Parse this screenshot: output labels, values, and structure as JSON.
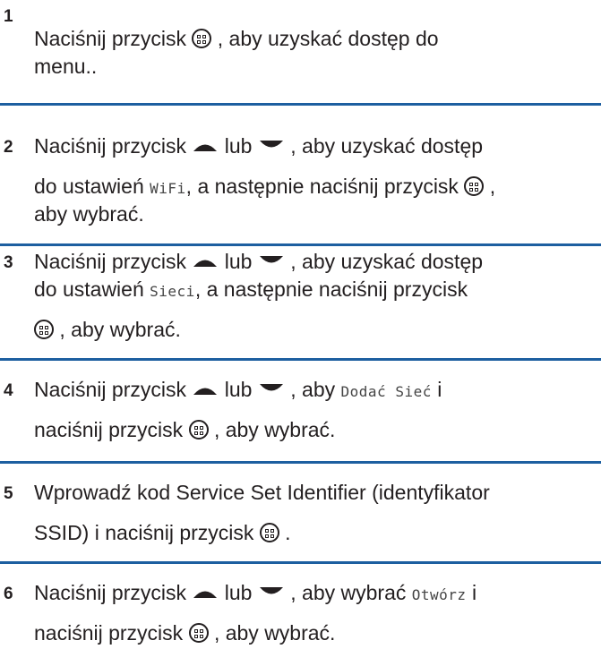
{
  "steps": [
    {
      "number": "1",
      "line1_pre": "Naciśnij przycisk",
      "line1_post": ", aby uzyskać dostęp do",
      "line2": "menu.."
    },
    {
      "number": "2",
      "line1_pre": "Naciśnij przycisk",
      "line1_or": "lub",
      "line1_post": ", aby uzyskać dostęp",
      "line2_pre": "do ustawień",
      "line2_mono": "WiFi",
      "line2_post": ", a następnie naciśnij przycisk",
      "line2_tail": ",",
      "line3": "aby wybrać."
    },
    {
      "number": "3",
      "line1_pre": "Naciśnij przycisk",
      "line1_or": "lub",
      "line1_post": ", aby uzyskać dostęp",
      "line2_pre": "do ustawień",
      "line2_mono": "Sieci",
      "line2_post": ", a następnie naciśnij przycisk",
      "line3_post": ", aby wybrać."
    },
    {
      "number": "4",
      "line1_pre": "Naciśnij przycisk",
      "line1_or": "lub",
      "line1_post": ", aby",
      "line1_mono": "Dodać Sieć",
      "line1_tail": "i",
      "line2_pre": "naciśnij przycisk",
      "line2_post": ", aby wybrać."
    },
    {
      "number": "5",
      "line1": "Wprowadź kod Service Set Identifier (identyfikator",
      "line2_pre": "SSID) i naciśnij przycisk",
      "line2_post": "."
    },
    {
      "number": "6",
      "line1_pre": "Naciśnij przycisk",
      "line1_or": "lub",
      "line1_post": ", aby wybrać",
      "line1_mono": "Otwórz",
      "line1_tail": "i",
      "line2_pre": "naciśnij przycisk",
      "line2_post": ", aby wybrać."
    }
  ],
  "icons": {
    "menu_ok": "menu-ok-button-icon",
    "up": "up-arrow-icon",
    "down": "down-arrow-icon"
  },
  "colors": {
    "separator": "#1d5fa0",
    "text": "#231f20"
  }
}
